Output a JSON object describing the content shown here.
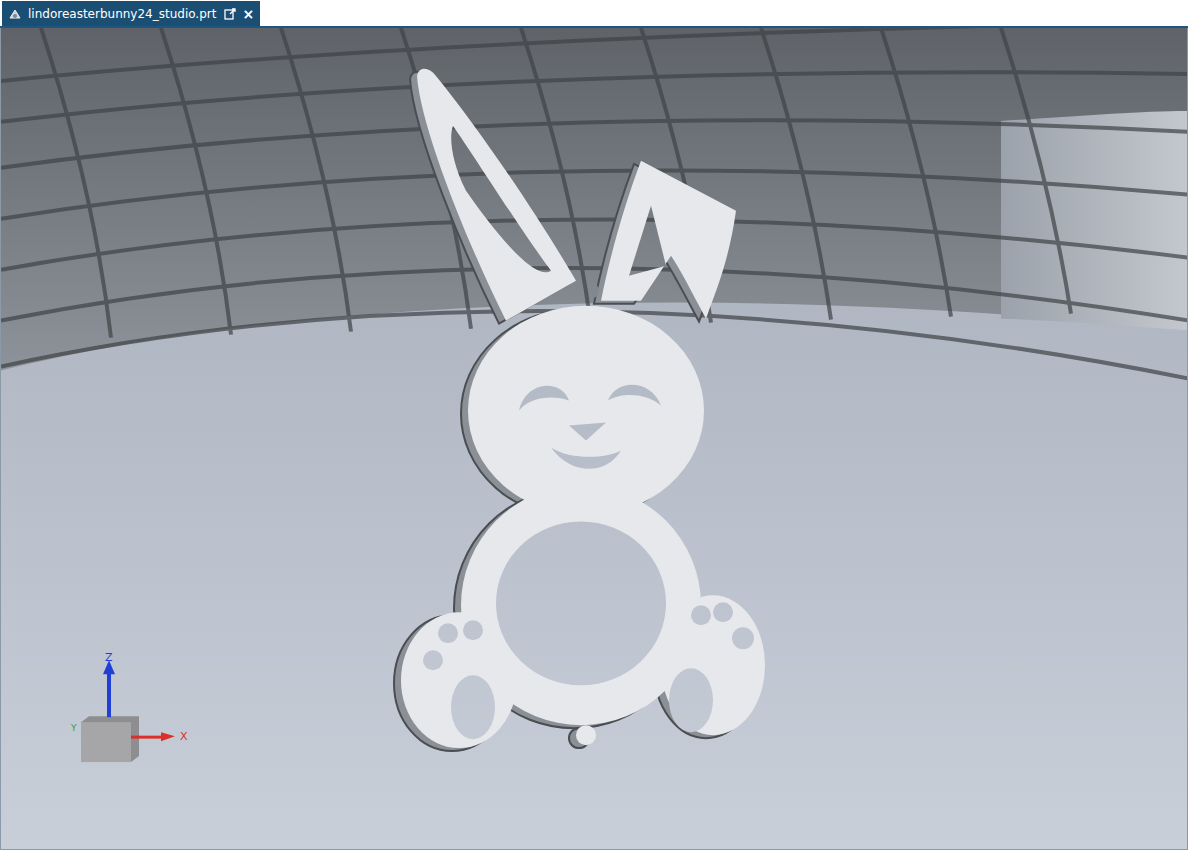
{
  "window": {
    "title": "lindoreasterbunny24_studio.prt"
  },
  "tabs": [
    {
      "label": "lindoreasterbunny24_studio.prt",
      "selected": true,
      "close": "×"
    }
  ],
  "triad": {
    "z": "Z",
    "x": "X",
    "y": "Y"
  }
}
